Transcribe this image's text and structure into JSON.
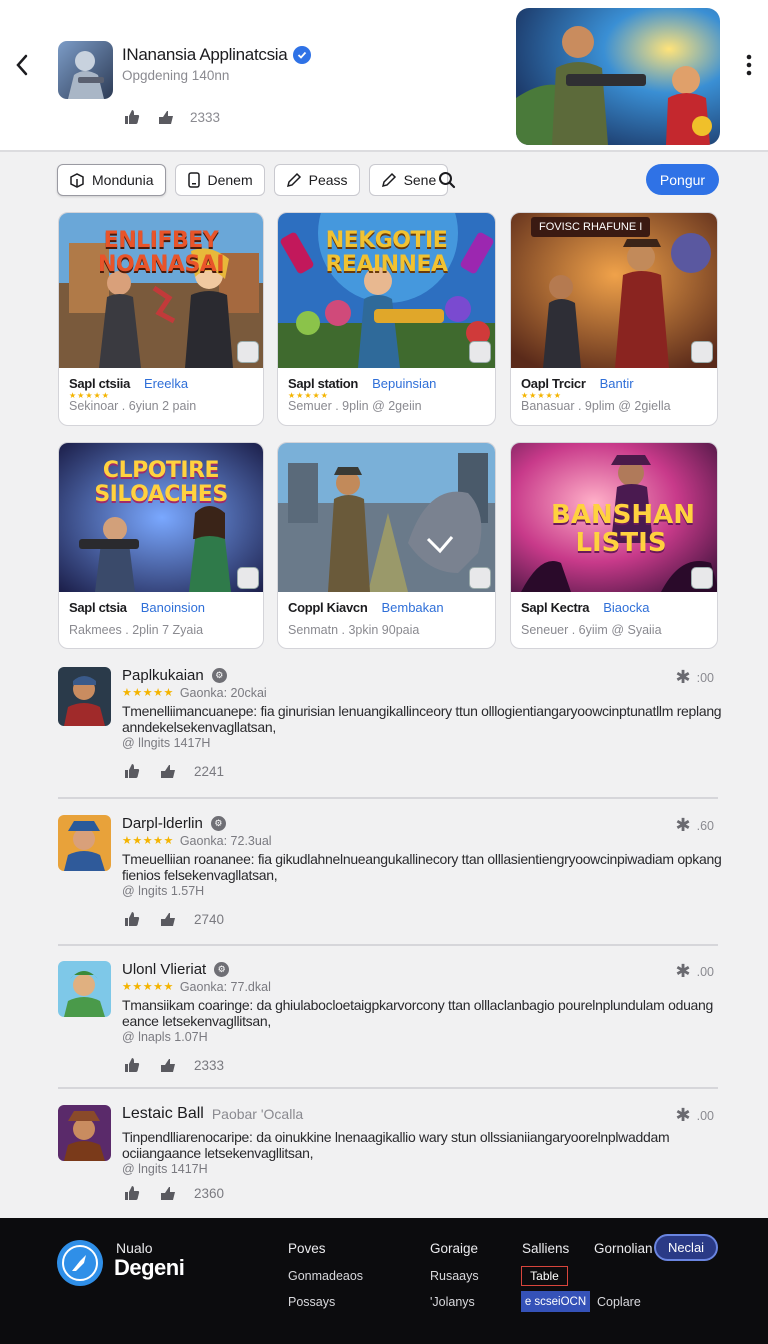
{
  "header": {
    "title": "INanansia Applinatcsia",
    "subtitle": "Opgdening 140nn",
    "stat": "2333"
  },
  "tabs": [
    {
      "label": "Mondunia",
      "icon": "app-box-icon"
    },
    {
      "label": "Denem",
      "icon": "phone-icon"
    },
    {
      "label": "Peass",
      "icon": "pen-icon"
    },
    {
      "label": "Sene",
      "icon": "pen-icon"
    }
  ],
  "primary_button": "Pongur",
  "cards": [
    {
      "banner": "ENLIFBEY NOANASAI",
      "banner_color": "#e8542a",
      "name": "Sapl ctsiia",
      "tag": "Ereelka",
      "meta": "Sekinoar . 6yiun 2 pain"
    },
    {
      "banner": "NEKGOTIE REAINNEA",
      "banner_color": "#f1c232",
      "name": "Sapl station",
      "tag": "Bepuinsian",
      "meta": "Semuer . 9plin @ 2geiin"
    },
    {
      "banner": "FOVISC RHAFUNE I",
      "banner_color": "#ffffff",
      "name": "Oapl Trcicr",
      "tag": "Bantir",
      "meta": "Banasuar . 9plim @ 2giella"
    },
    {
      "banner": "CLPOTIRE SILOACHES",
      "banner_color": "#ffd23f",
      "name": "Sapl ctsia",
      "tag": "Banoinsion",
      "meta": "Rakmees . 2plin 7 Zyaia"
    },
    {
      "banner": "",
      "banner_color": "#ffffff",
      "name": "Coppl Kiavcn",
      "tag": "Bembakan",
      "meta": "Senmatn . 3pkin 90paia"
    },
    {
      "banner": "BANSHAN LISTIS",
      "banner_color": "#ffd23f",
      "name": "Sapl Kectra",
      "tag": "Biaocka",
      "meta": "Seneuer . 6yiim @ Syaiia"
    }
  ],
  "reviews": [
    {
      "name": "Paplkukaian",
      "extra": "",
      "rating": "Gaonka: 20ckai",
      "text": "Tmenelliimancuanepe: fia ginurisian lenuangikallinceory ttun olllogientiangaryoowcinptunatllm replang anndekelsekenvagllatsan,",
      "meta": "@ llngits 1417H",
      "likes": "2241",
      "score": ":00"
    },
    {
      "name": "Darpl-lderlin",
      "extra": "",
      "rating": "Gaonka: 72.3ual",
      "text": "Tmeuelliian roananee: fia gikudlahnelnueangukallinecory ttan olllasientiengryoowcinpiwadiam opkang fienios felsekenvagllatsan,",
      "meta": "@ lngits 1.57H",
      "likes": "2740",
      "score": ".60"
    },
    {
      "name": "Ulonl Vlieriat",
      "extra": "",
      "rating": "Gaonka: 77.dkal",
      "text": "Tmansiikam coaringe: da ghiulabocloetaigpkarvorcony ttan olllaclanbagio pourelnplundulam oduang eance letsekenvagllitsan,",
      "meta": "@ lnapls 1.07H",
      "likes": "2333",
      "score": ".00"
    },
    {
      "name": "Lestaic Ball",
      "extra": "Paobar 'Ocalla",
      "rating": "",
      "text": "Tinpendlliarenocaripe: da oinukkine lnenaagikallio wary stun ollssianiiangaryoorelnplwaddam ociiangaance letsekenvagllitsan,",
      "meta": "@ lngits 1417H",
      "likes": "2360",
      "score": ".00"
    }
  ],
  "footer": {
    "brand_top": "Nualo",
    "brand_bottom": "Degeni",
    "col1": [
      "Poves",
      "Gonmadeaos",
      "Possays"
    ],
    "col2": [
      "Goraige",
      "Rusaays",
      "'Jolanys"
    ],
    "col3_top": "Salliens",
    "col3_red": "Table",
    "col3_blue": "e scseiOCN",
    "col4_top": "Gornolian",
    "col4_bottom": "Coplare",
    "pill": "Neclai"
  },
  "colors": {
    "accent": "#2f72e6",
    "footer_bg": "#0c0c0e",
    "star": "#f4b400"
  }
}
